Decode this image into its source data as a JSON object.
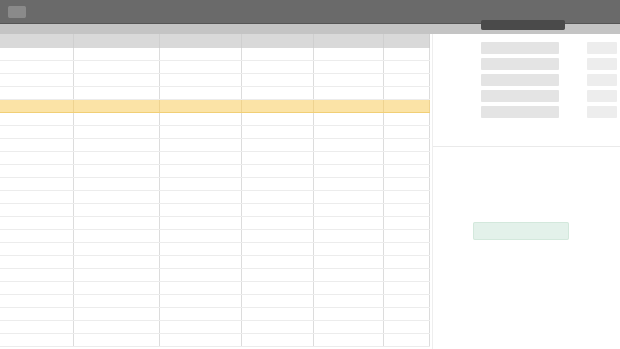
{
  "window": {
    "title": ""
  },
  "grid": {
    "columns": [
      "",
      "",
      "",
      "",
      "",
      ""
    ],
    "rows": [
      [
        "",
        "",
        "",
        "",
        "",
        ""
      ],
      [
        "",
        "",
        "",
        "",
        "",
        ""
      ],
      [
        "",
        "",
        "",
        "",
        "",
        ""
      ],
      [
        "",
        "",
        "",
        "",
        "",
        ""
      ],
      [
        "",
        "",
        "",
        "",
        "",
        ""
      ],
      [
        "",
        "",
        "",
        "",
        "",
        ""
      ],
      [
        "",
        "",
        "",
        "",
        "",
        ""
      ],
      [
        "",
        "",
        "",
        "",
        "",
        ""
      ],
      [
        "",
        "",
        "",
        "",
        "",
        ""
      ],
      [
        "",
        "",
        "",
        "",
        "",
        ""
      ],
      [
        "",
        "",
        "",
        "",
        "",
        ""
      ],
      [
        "",
        "",
        "",
        "",
        "",
        ""
      ],
      [
        "",
        "",
        "",
        "",
        "",
        ""
      ],
      [
        "",
        "",
        "",
        "",
        "",
        ""
      ],
      [
        "",
        "",
        "",
        "",
        "",
        ""
      ],
      [
        "",
        "",
        "",
        "",
        "",
        ""
      ],
      [
        "",
        "",
        "",
        "",
        "",
        ""
      ],
      [
        "",
        "",
        "",
        "",
        "",
        ""
      ],
      [
        "",
        "",
        "",
        "",
        "",
        ""
      ],
      [
        "",
        "",
        "",
        "",
        "",
        ""
      ],
      [
        "",
        "",
        "",
        "",
        "",
        ""
      ],
      [
        "",
        "",
        "",
        "",
        "",
        ""
      ],
      [
        "",
        "",
        "",
        "",
        "",
        ""
      ]
    ],
    "selected_row_index": 4
  },
  "panel": {
    "title": "",
    "properties": [
      {
        "label": "",
        "value": ""
      },
      {
        "label": "",
        "value": ""
      },
      {
        "label": "",
        "value": ""
      },
      {
        "label": "",
        "value": ""
      },
      {
        "label": "",
        "value": ""
      }
    ],
    "mark": "",
    "action_label": ""
  },
  "colors": {
    "titlebar": "#6a6a6a",
    "header": "#d9d9d9",
    "selected_row": "#fbe3a6",
    "action": "#e3f1ea"
  },
  "icons": {
    "app": "app-icon"
  }
}
